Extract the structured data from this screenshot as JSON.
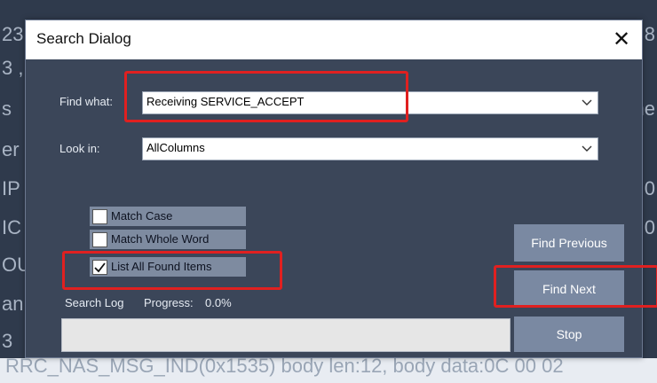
{
  "background": {
    "left_fragments": [
      "23",
      "3 ,",
      "s",
      "er",
      "IP",
      "IC",
      "OU",
      "an",
      "3"
    ],
    "right_fragments": [
      "0 8",
      "",
      "he",
      "",
      "4 0",
      "F 0"
    ],
    "bottom_text": "RRC_NAS_MSG_IND(0x1535) body len:12, body data:0C 00 02"
  },
  "dialog": {
    "title": "Search Dialog",
    "close_glyph": "✕",
    "find_what": {
      "label": "Find what:",
      "value": "Receiving SERVICE_ACCEPT"
    },
    "look_in": {
      "label": "Look in:",
      "value": "AllColumns"
    },
    "options": [
      {
        "label": "Match Case",
        "checked": false
      },
      {
        "label": "Match Whole Word",
        "checked": false
      },
      {
        "label": "List All Found Items",
        "checked": true
      }
    ],
    "search_log_label": "Search Log",
    "progress_label": "Progress:",
    "progress_value": "0.0%",
    "progress_fraction": 0.0,
    "buttons": {
      "find_previous": "Find Previous",
      "find_next": "Find Next",
      "stop": "Stop"
    }
  },
  "colors": {
    "annotation": "#e02020",
    "dialog_bg": "#3b4659",
    "button_bg": "#7a89a2"
  }
}
